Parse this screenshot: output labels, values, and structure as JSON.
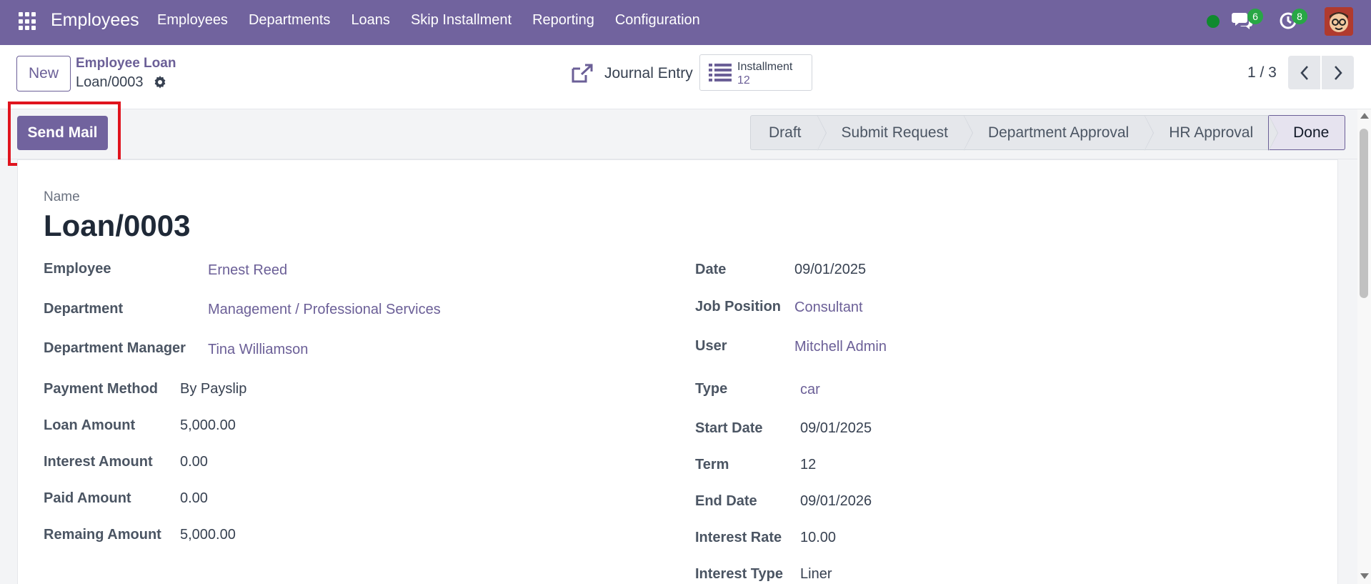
{
  "navbar": {
    "app_name": "Employees",
    "menu": [
      "Employees",
      "Departments",
      "Loans",
      "Skip Installment",
      "Reporting",
      "Configuration"
    ],
    "messages_count": "6",
    "activities_count": "8",
    "status_color": "#0f8a2e",
    "accent_color": "#71639e"
  },
  "control": {
    "new_label": "New",
    "breadcrumb_parent": "Employee Loan",
    "breadcrumb_current": "Loan/0003",
    "journal_label": "Journal Entry",
    "installment_label": "Installment",
    "installment_count": "12",
    "pager": "1 / 3"
  },
  "statusbar": {
    "send_mail": "Send Mail",
    "stages": [
      "Draft",
      "Submit Request",
      "Department Approval",
      "HR Approval",
      "Done"
    ],
    "active_stage": "Done"
  },
  "form": {
    "name_label": "Name",
    "name": "Loan/0003",
    "left": [
      {
        "label": "Employee",
        "value": "Ernest Reed"
      },
      {
        "label": "Department",
        "value": "Management / Professional Services"
      },
      {
        "label": "Department Manager",
        "value": "Tina Williamson"
      },
      {
        "label": "Payment Method",
        "value": "By Payslip"
      },
      {
        "label": "Loan Amount",
        "value": "5,000.00"
      },
      {
        "label": "Interest Amount",
        "value": "0.00"
      },
      {
        "label": "Paid Amount",
        "value": "0.00"
      },
      {
        "label": "Remaing Amount",
        "value": "5,000.00"
      }
    ],
    "right": [
      {
        "label": "Date",
        "value": "09/01/2025"
      },
      {
        "label": "Job Position",
        "value": "Consultant"
      },
      {
        "label": "User",
        "value": "Mitchell Admin"
      },
      {
        "label": "Type",
        "value": "car"
      },
      {
        "label": "Start Date",
        "value": "09/01/2025"
      },
      {
        "label": "Term",
        "value": "12"
      },
      {
        "label": "End Date",
        "value": "09/01/2026"
      },
      {
        "label": "Interest Rate",
        "value": "10.00"
      },
      {
        "label": "Interest Type",
        "value": "Liner"
      }
    ]
  }
}
